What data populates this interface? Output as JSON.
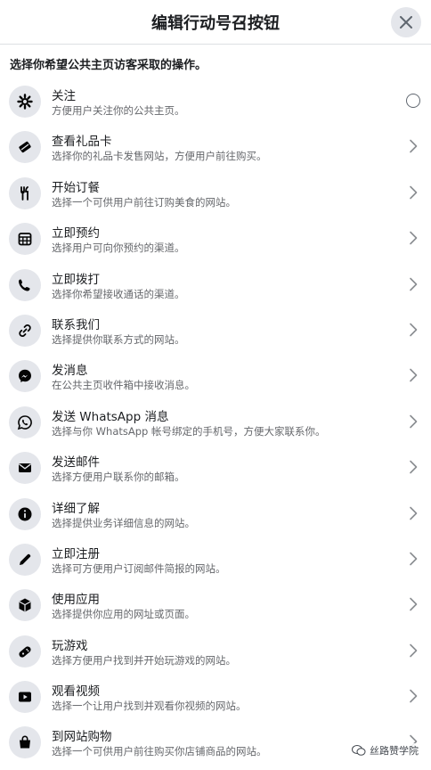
{
  "header": {
    "title": "编辑行动号召按钮"
  },
  "prompt": "选择你希望公共主页访客采取的操作。",
  "items": [
    {
      "title": "关注",
      "desc": "方便用户关注你的公共主页。",
      "icon": "gear-icon",
      "control": "radio"
    },
    {
      "title": "查看礼品卡",
      "desc": "选择你的礼品卡发售网站，方便用户前往购买。",
      "icon": "gift-card-icon",
      "control": "chevron"
    },
    {
      "title": "开始订餐",
      "desc": "选择一个可供用户前往订购美食的网站。",
      "icon": "fork-knife-icon",
      "control": "chevron"
    },
    {
      "title": "立即预约",
      "desc": "选择用户可向你预约的渠道。",
      "icon": "calendar-icon",
      "control": "chevron"
    },
    {
      "title": "立即拨打",
      "desc": "选择你希望接收通话的渠道。",
      "icon": "phone-icon",
      "control": "chevron"
    },
    {
      "title": "联系我们",
      "desc": "选择提供你联系方式的网站。",
      "icon": "link-icon",
      "control": "chevron"
    },
    {
      "title": "发消息",
      "desc": "在公共主页收件箱中接收消息。",
      "icon": "messenger-icon",
      "control": "chevron"
    },
    {
      "title": "发送 WhatsApp 消息",
      "desc": "选择与你 WhatsApp 帐号绑定的手机号，方便大家联系你。",
      "icon": "whatsapp-icon",
      "control": "chevron"
    },
    {
      "title": "发送邮件",
      "desc": "选择方便用户联系你的邮箱。",
      "icon": "envelope-icon",
      "control": "chevron"
    },
    {
      "title": "详细了解",
      "desc": "选择提供业务详细信息的网站。",
      "icon": "info-icon",
      "control": "chevron"
    },
    {
      "title": "立即注册",
      "desc": "选择可方便用户订阅邮件简报的网站。",
      "icon": "pencil-icon",
      "control": "chevron"
    },
    {
      "title": "使用应用",
      "desc": "选择提供你应用的网址或页面。",
      "icon": "cube-icon",
      "control": "chevron"
    },
    {
      "title": "玩游戏",
      "desc": "选择方便用户找到并开始玩游戏的网站。",
      "icon": "gamepad-icon",
      "control": "chevron"
    },
    {
      "title": "观看视频",
      "desc": "选择一个让用户找到并观看你视频的网站。",
      "icon": "video-icon",
      "control": "chevron"
    },
    {
      "title": "到网站购物",
      "desc": "选择一个可供用户前往购买你店铺商品的网站。",
      "icon": "shopping-bag-icon",
      "control": "chevron"
    }
  ],
  "watermark": "丝路赞学院",
  "colors": {
    "icon_bg": "#e4e6eb",
    "title": "#1c1e21",
    "desc": "#65676b",
    "chevron": "#8a8d91"
  }
}
